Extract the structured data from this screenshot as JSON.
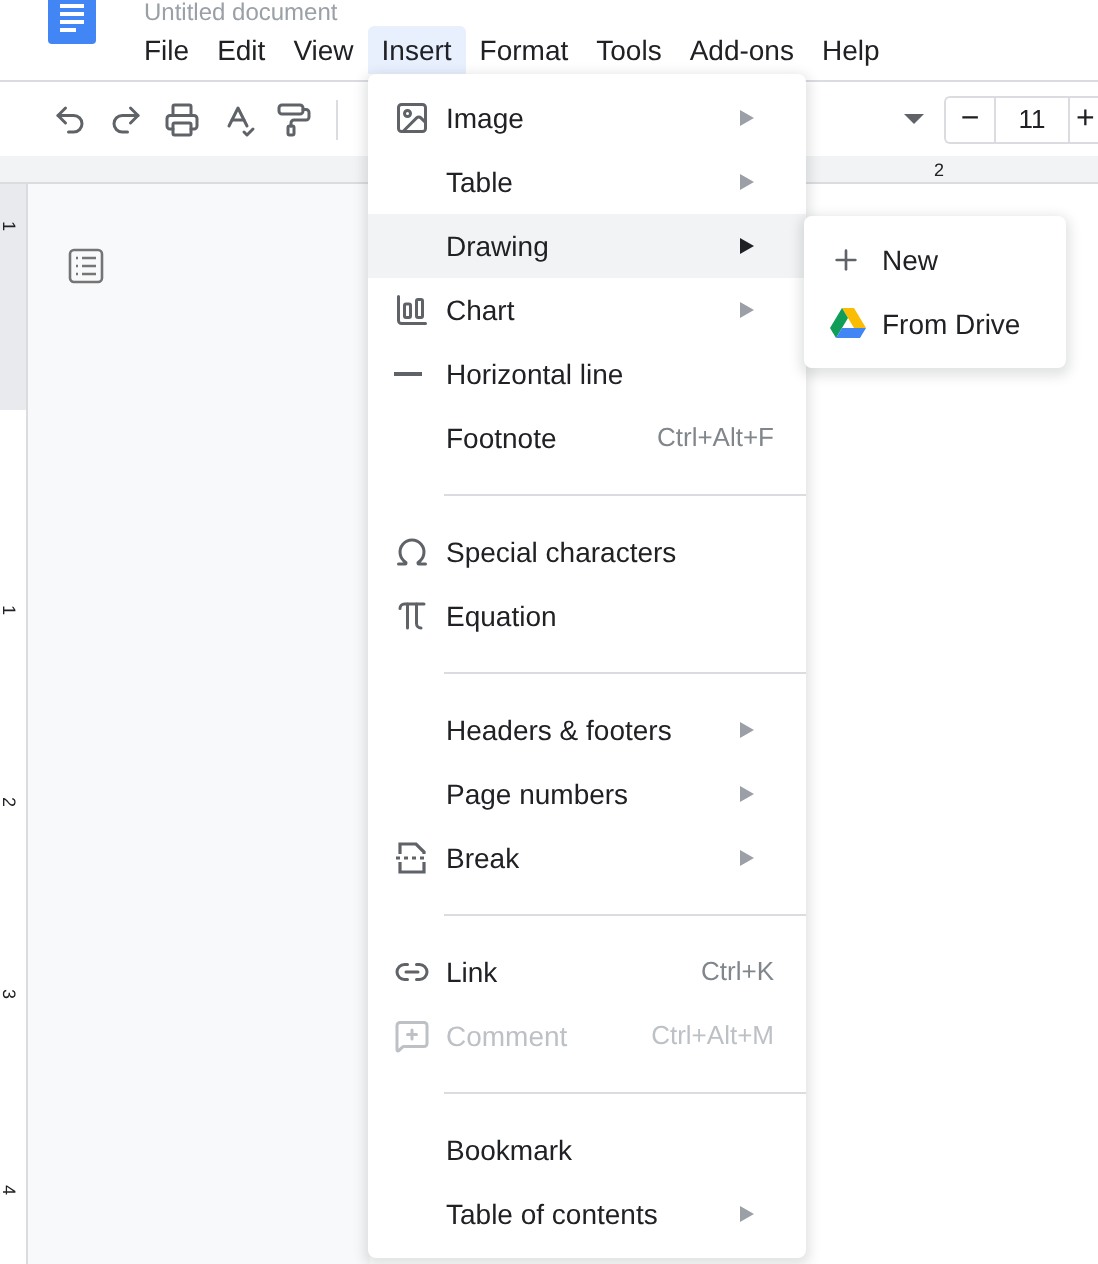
{
  "document": {
    "title": "Untitled document"
  },
  "menubar": [
    {
      "label": "File",
      "selected": false
    },
    {
      "label": "Edit",
      "selected": false
    },
    {
      "label": "View",
      "selected": false
    },
    {
      "label": "Insert",
      "selected": true
    },
    {
      "label": "Format",
      "selected": false
    },
    {
      "label": "Tools",
      "selected": false
    },
    {
      "label": "Add-ons",
      "selected": false
    },
    {
      "label": "Help",
      "selected": false
    }
  ],
  "toolbar": {
    "font_size": {
      "decrease": "−",
      "value": "11",
      "increase": "+"
    }
  },
  "ruler": {
    "horizontal": [
      "2"
    ],
    "vertical": [
      "1",
      "1",
      "2",
      "3",
      "4"
    ]
  },
  "insert_menu": [
    {
      "kind": "item",
      "label": "Image",
      "submenu": true,
      "selected": false,
      "disabled": false
    },
    {
      "kind": "item",
      "label": "Table",
      "submenu": true,
      "selected": false,
      "disabled": false
    },
    {
      "kind": "item",
      "label": "Drawing",
      "submenu": true,
      "selected": true,
      "disabled": false
    },
    {
      "kind": "item",
      "label": "Chart",
      "submenu": true,
      "selected": false,
      "disabled": false
    },
    {
      "kind": "item",
      "label": "Horizontal line",
      "submenu": false,
      "selected": false,
      "disabled": false
    },
    {
      "kind": "item",
      "label": "Footnote",
      "shortcut": "Ctrl+Alt+F",
      "submenu": false,
      "selected": false,
      "disabled": false
    },
    {
      "kind": "divider"
    },
    {
      "kind": "item",
      "label": "Special characters",
      "submenu": false,
      "selected": false,
      "disabled": false
    },
    {
      "kind": "item",
      "label": "Equation",
      "submenu": false,
      "selected": false,
      "disabled": false
    },
    {
      "kind": "divider"
    },
    {
      "kind": "item",
      "label": "Headers & footers",
      "submenu": true,
      "selected": false,
      "disabled": false
    },
    {
      "kind": "item",
      "label": "Page numbers",
      "submenu": true,
      "selected": false,
      "disabled": false
    },
    {
      "kind": "item",
      "label": "Break",
      "submenu": true,
      "selected": false,
      "disabled": false
    },
    {
      "kind": "divider"
    },
    {
      "kind": "item",
      "label": "Link",
      "shortcut": "Ctrl+K",
      "submenu": false,
      "selected": false,
      "disabled": false
    },
    {
      "kind": "item",
      "label": "Comment",
      "shortcut": "Ctrl+Alt+M",
      "submenu": false,
      "selected": false,
      "disabled": true
    },
    {
      "kind": "divider"
    },
    {
      "kind": "item",
      "label": "Bookmark",
      "submenu": false,
      "selected": false,
      "disabled": false
    },
    {
      "kind": "item",
      "label": "Table of contents",
      "submenu": true,
      "selected": false,
      "disabled": false
    }
  ],
  "drawing_submenu": [
    {
      "label": "New"
    },
    {
      "label": "From Drive"
    }
  ]
}
